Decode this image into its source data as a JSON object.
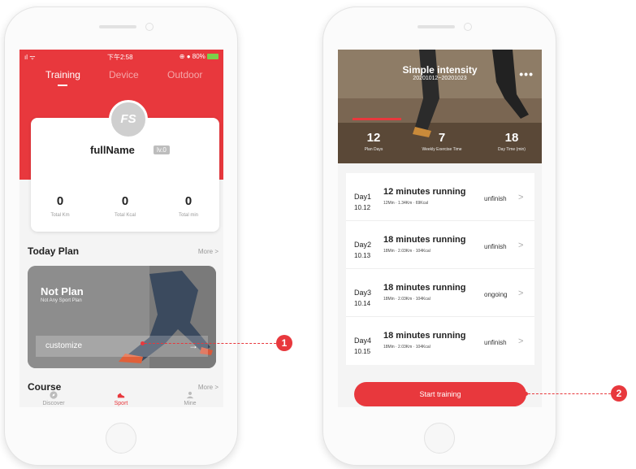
{
  "colors": {
    "accent": "#e8383d",
    "active_green": "#7bd14a"
  },
  "phone1": {
    "status": {
      "signal": "ıl ᯤ",
      "time": "下午2:58",
      "battery": "⊕ ● 80%"
    },
    "tabs": [
      {
        "label": "Training",
        "active": true
      },
      {
        "label": "Device",
        "active": false
      },
      {
        "label": "Outdoor",
        "active": false
      }
    ],
    "profile": {
      "avatar_text": "FS",
      "name": "fullName",
      "level": "lv.0",
      "stats": [
        {
          "value": "0",
          "label": "Total Km"
        },
        {
          "value": "0",
          "label": "Total Kcal"
        },
        {
          "value": "0",
          "label": "Total min"
        }
      ]
    },
    "today_plan": {
      "title": "Today Plan",
      "more": "More >",
      "card_title": "Not Plan",
      "card_subtitle": "Not Any Sport Plan",
      "customize": "customize",
      "arrow": "→"
    },
    "course": {
      "title": "Course",
      "more": "More >"
    },
    "nav": [
      {
        "label": "Discover",
        "icon": "compass-icon"
      },
      {
        "label": "Sport",
        "icon": "shoe-icon"
      },
      {
        "label": "Mine",
        "icon": "person-icon"
      }
    ]
  },
  "phone2": {
    "hero": {
      "title": "Simple intensity",
      "date_range": "20201012~20201023",
      "more": "•••",
      "stats": [
        {
          "value": "12",
          "label": "Plan Days"
        },
        {
          "value": "7",
          "label": "Weekly Exercise Time"
        },
        {
          "value": "18",
          "label": "Day Time (min)"
        }
      ]
    },
    "days": [
      {
        "day": "Day1",
        "date": "10.12",
        "title": "12 minutes running",
        "meta": "12Min · 1.34Km · 69Kcal",
        "status": "unfinish"
      },
      {
        "day": "Day2",
        "date": "10.13",
        "title": "18 minutes running",
        "meta": "18Min · 2.03Km · 104Kcal",
        "status": "unfinish"
      },
      {
        "day": "Day3",
        "date": "10.14",
        "title": "18 minutes running",
        "meta": "18Min · 2.03Km · 104Kcal",
        "status": "ongoing"
      },
      {
        "day": "Day4",
        "date": "10.15",
        "title": "18 minutes running",
        "meta": "18Min · 2.03Km · 104Kcal",
        "status": "unfinish"
      }
    ],
    "start_button": "Start training"
  },
  "callouts": [
    {
      "number": "1"
    },
    {
      "number": "2"
    }
  ]
}
